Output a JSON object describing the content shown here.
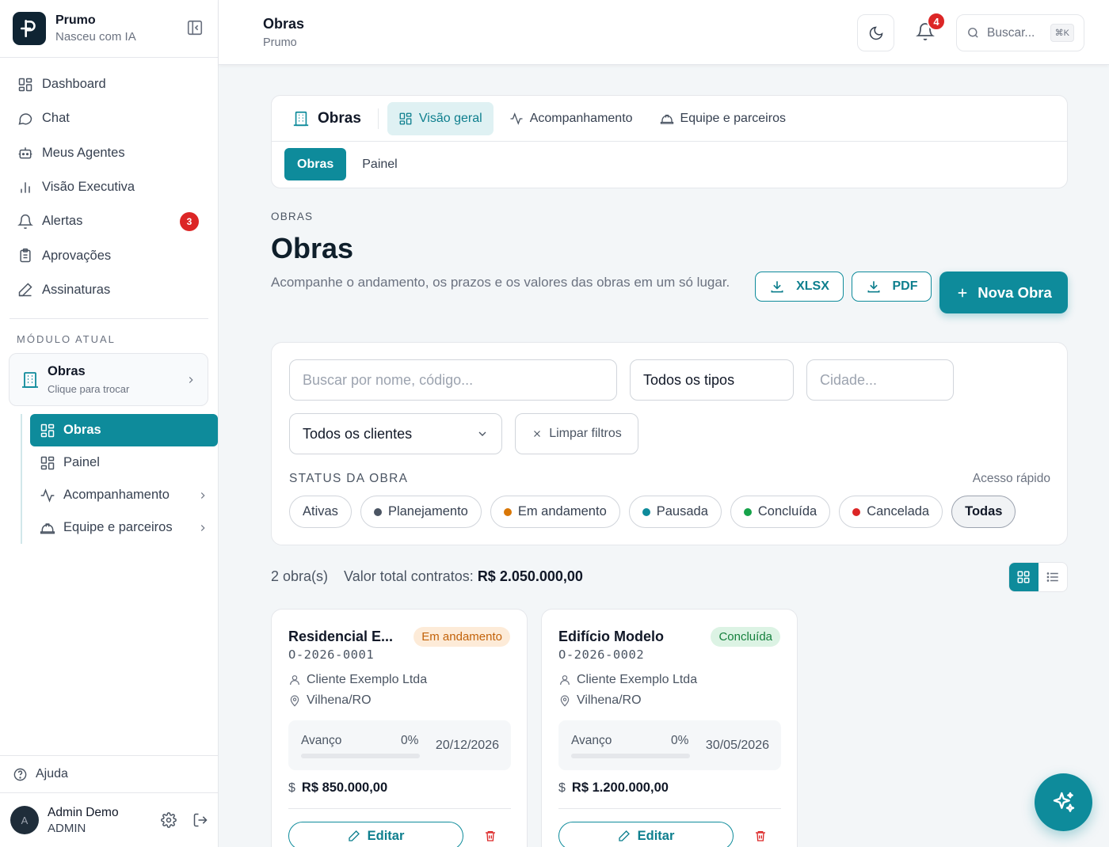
{
  "brand": {
    "name": "Prumo",
    "tagline": "Nasceu com IA"
  },
  "nav": {
    "items": [
      {
        "label": "Dashboard",
        "icon": "grid-icon"
      },
      {
        "label": "Chat",
        "icon": "chat-icon"
      },
      {
        "label": "Meus Agentes",
        "icon": "bot-icon"
      },
      {
        "label": "Visão Executiva",
        "icon": "bar-chart-icon"
      },
      {
        "label": "Alertas",
        "icon": "bell-icon",
        "badge": "3"
      },
      {
        "label": "Aprovações",
        "icon": "clipboard-icon"
      },
      {
        "label": "Assinaturas",
        "icon": "pen-icon"
      }
    ]
  },
  "module": {
    "section_label": "MÓDULO ATUAL",
    "title": "Obras",
    "subtitle": "Clique para trocar",
    "items": [
      {
        "label": "Obras",
        "icon": "grid-icon",
        "active": true
      },
      {
        "label": "Painel",
        "icon": "grid-icon"
      },
      {
        "label": "Acompanhamento",
        "icon": "activity-icon"
      },
      {
        "label": "Equipe e parceiros",
        "icon": "hard-hat-icon"
      }
    ]
  },
  "sidebar_footer": {
    "help": "Ajuda",
    "user": {
      "initial": "A",
      "name": "Admin Demo",
      "role": "ADMIN"
    }
  },
  "topbar": {
    "title": "Obras",
    "subtitle": "Prumo",
    "notifications": "4",
    "search_placeholder": "Buscar...",
    "search_shortcut": "⌘K"
  },
  "tabs": {
    "module": "Obras",
    "items": [
      {
        "label": "Visão geral",
        "icon": "grid-icon",
        "active": true
      },
      {
        "label": "Acompanhamento",
        "icon": "activity-icon"
      },
      {
        "label": "Equipe e parceiros",
        "icon": "hard-hat-icon"
      }
    ],
    "subtabs": [
      {
        "label": "Obras",
        "active": true
      },
      {
        "label": "Painel"
      }
    ]
  },
  "page": {
    "eyebrow": "OBRAS",
    "title": "Obras",
    "description": "Acompanhe o andamento, os prazos e os valores das obras em um só lugar.",
    "btn_xlsx": "XLSX",
    "btn_pdf": "PDF",
    "btn_new": "Nova Obra"
  },
  "filters": {
    "search_placeholder": "Buscar por nome, código...",
    "type_value": "Todos os tipos",
    "city_placeholder": "Cidade...",
    "client_value": "Todos os clientes",
    "clear_label": "Limpar filtros",
    "status_label": "STATUS DA OBRA",
    "quick_label": "Acesso rápido",
    "chips": [
      {
        "label": "Ativas",
        "dot": ""
      },
      {
        "label": "Planejamento",
        "dot": "#4b5563"
      },
      {
        "label": "Em andamento",
        "dot": "#d97706"
      },
      {
        "label": "Pausada",
        "dot": "#0e8b9b"
      },
      {
        "label": "Concluída",
        "dot": "#16a34a"
      },
      {
        "label": "Cancelada",
        "dot": "#dc2626"
      },
      {
        "label": "Todas",
        "dot": "",
        "active": true
      }
    ]
  },
  "summary": {
    "count": "2 obra(s)",
    "total_label": "Valor total contratos:",
    "total_value": "R$ 2.050.000,00"
  },
  "cards": [
    {
      "title": "Residencial E...",
      "status": "Em andamento",
      "status_bg": "#fdebd8",
      "status_color": "#c2620a",
      "code": "O-2026-0001",
      "client": "Cliente Exemplo Ltda",
      "city": "Vilhena/RO",
      "progress_label": "Avanço",
      "progress_pct": 0,
      "progress_text": "0%",
      "date": "20/12/2026",
      "value": "R$ 850.000,00",
      "edit_label": "Editar"
    },
    {
      "title": "Edifício Modelo",
      "status": "Concluída",
      "status_bg": "#dcf3e4",
      "status_color": "#15803d",
      "code": "O-2026-0002",
      "client": "Cliente Exemplo Ltda",
      "city": "Vilhena/RO",
      "progress_label": "Avanço",
      "progress_pct": 0,
      "progress_text": "0%",
      "date": "30/05/2026",
      "value": "R$ 1.200.000,00",
      "edit_label": "Editar"
    }
  ],
  "colors": {
    "accent": "#0e8b9b",
    "danger": "#dc2626"
  }
}
